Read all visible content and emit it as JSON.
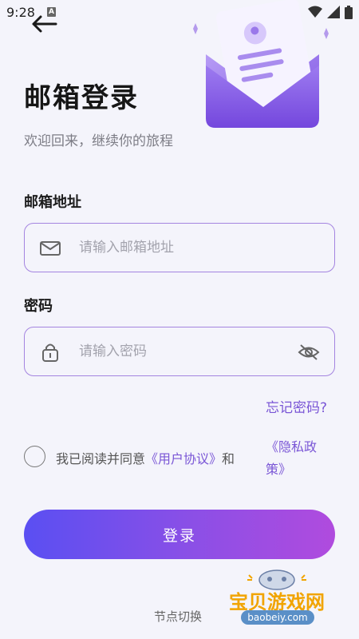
{
  "status_bar": {
    "time": "9:28",
    "notification_letter": "A"
  },
  "header": {
    "title": "邮箱登录",
    "subtitle": "欢迎回来，继续你的旅程"
  },
  "email": {
    "label": "邮箱地址",
    "placeholder": "请输入邮箱地址",
    "value": ""
  },
  "password": {
    "label": "密码",
    "placeholder": "请输入密码",
    "value": ""
  },
  "forgot_password": "忘记密码?",
  "agreement": {
    "prefix": "我已阅读并同意",
    "user_agreement": "《用户协议》",
    "and": "和",
    "privacy_part1": "《隐私政",
    "privacy_part2": "策》",
    "checked": false
  },
  "login_button": "登录",
  "node_switch": "节点切换",
  "watermark": {
    "text": "宝贝游戏网",
    "url": "baobeiy.com"
  },
  "colors": {
    "accent": "#7a56d6",
    "field_border": "#a484e0",
    "button_gradient_start": "#5a4ff2",
    "button_gradient_end": "#b04bde",
    "background": "#f4f4fb"
  },
  "icons": [
    "back-arrow-icon",
    "envelope-icon",
    "lock-icon",
    "eye-hidden-icon",
    "wifi-icon",
    "signal-icon",
    "battery-icon"
  ]
}
